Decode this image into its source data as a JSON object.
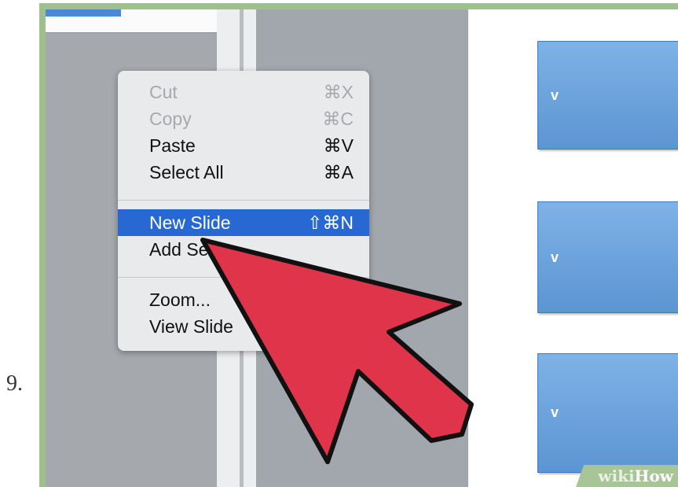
{
  "step": {
    "number": "9."
  },
  "context_menu": {
    "items": [
      {
        "label": "Cut",
        "shortcut": "⌘X",
        "enabled": false
      },
      {
        "label": "Copy",
        "shortcut": "⌘C",
        "enabled": false
      },
      {
        "label": "Paste",
        "shortcut": "⌘V",
        "enabled": true
      },
      {
        "label": "Select All",
        "shortcut": "⌘A",
        "enabled": true
      },
      {
        "label": "New Slide",
        "shortcut": "⇧⌘N",
        "enabled": true,
        "highlighted": true
      },
      {
        "label": "Add Se",
        "shortcut": "",
        "enabled": true
      },
      {
        "label": "Zoom...",
        "shortcut": "",
        "enabled": true
      },
      {
        "label": "View Slide",
        "shortcut": "",
        "enabled": true
      }
    ]
  },
  "slides": [
    {
      "label": "v"
    },
    {
      "label": "v"
    },
    {
      "label": "v"
    }
  ],
  "watermark": {
    "part1": "wiki",
    "part2": "How"
  },
  "colors": {
    "highlight": "#2868d3",
    "arrow_fill": "#e0344a",
    "frame": "#9ec08f",
    "slide_box": "#5b95d3"
  }
}
